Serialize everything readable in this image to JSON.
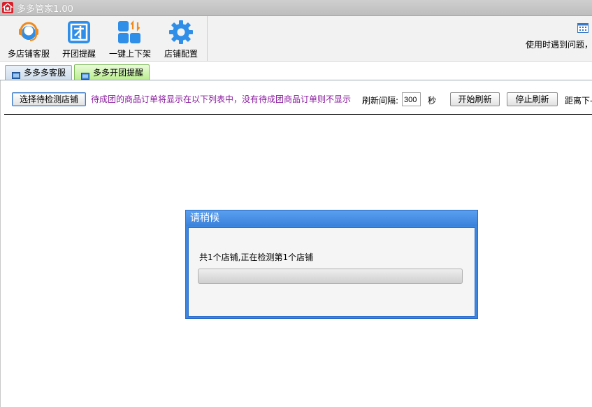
{
  "window": {
    "title": "多多管家1.00"
  },
  "toolbar": {
    "buttons": [
      {
        "label": "多店铺客服",
        "icon": "headset-icon"
      },
      {
        "label": "开团提醒",
        "icon": "group-icon"
      },
      {
        "label": "一键上下架",
        "icon": "listing-icon"
      },
      {
        "label": "店铺配置",
        "icon": "gear-icon"
      }
    ],
    "help_text": "使用时遇到问题，"
  },
  "tabs": [
    {
      "label": "多多多客服",
      "active": false
    },
    {
      "label": "多多开团提醒",
      "active": true
    }
  ],
  "controls": {
    "select_shop_button": "选择待检测店铺",
    "hint": "待成团的商品订单将显示在以下列表中，没有待成团商品订单则不显示",
    "refresh_interval_label": "刷新间隔:",
    "refresh_interval_value": "300",
    "seconds_label": "秒",
    "start_button": "开始刷新",
    "stop_button": "停止刷新",
    "next_label": "距离下-"
  },
  "dialog": {
    "title": "请稍候",
    "message": "共1个店铺,正在检测第1个店铺",
    "progress": 0
  },
  "colors": {
    "hint_text": "#8a1a9e",
    "icon_blue": "#2e8ee8",
    "dialog_blue": "#3d86e0"
  }
}
